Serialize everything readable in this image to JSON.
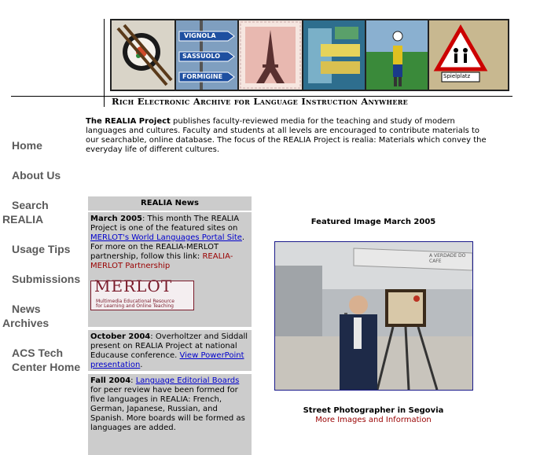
{
  "banner": {
    "tagline": "Rich Electronic Archive for Language Instruction Anywhere",
    "sign_words": [
      "VIGNOLA",
      "SASSUOLO",
      "FORMIGINE"
    ],
    "street_sign": "Spielplatz"
  },
  "intro": {
    "bold_lead": "The REALIA Project",
    "text": " publishes faculty-reviewed media for the teaching and study of modern languages and cultures. Faculty and students at all levels are encouraged to contribute materials to our searchable, online database. The focus of the REALIA Project is realia: Materials which convey the everyday life of different cultures."
  },
  "nav": {
    "home": "Home",
    "about": "About Us",
    "search_1": "Search",
    "search_2": "REALIA",
    "usage": "Usage Tips",
    "submissions": "Submissions",
    "news_1": "News",
    "news_2": "Archives",
    "acs_1": "ACS Tech",
    "acs_2": "Center Home"
  },
  "news": {
    "header": "REALIA News",
    "item1": {
      "date": "March 2005",
      "text_a": ": This month The REALIA Project is one of the featured sites on ",
      "link": "MERLOT's World Languages Portal Site",
      "text_b": ". For more on the REALIA-MERLOT partnership, follow this link: ",
      "red_link": "REALIA-MERLOT Partnership"
    },
    "merlot": {
      "logo": "MERLOT",
      "sub1": "Multimedia Educational Resource",
      "sub2": "for Learning and Online Teaching"
    },
    "item2": {
      "date": "October 2004",
      "text_a": ": Overholtzer and Siddall present on REALIA Project at national Educause conference. ",
      "link": "View PowerPoint presentation",
      "text_b": "."
    },
    "item3": {
      "date": "Fall 2004",
      "text_a": ": ",
      "link": "Language Editorial Boards",
      "text_b": " for peer review have been formed for five languages in REALIA: French, German, Japanese, Russian, and Spanish. More boards will be formed as languages are added."
    }
  },
  "featured": {
    "title": "Featured Image March 2005",
    "caption": "Street Photographer in Segovia",
    "more": "More Images and Information",
    "awning": "A VERDADE DO CAFE"
  }
}
